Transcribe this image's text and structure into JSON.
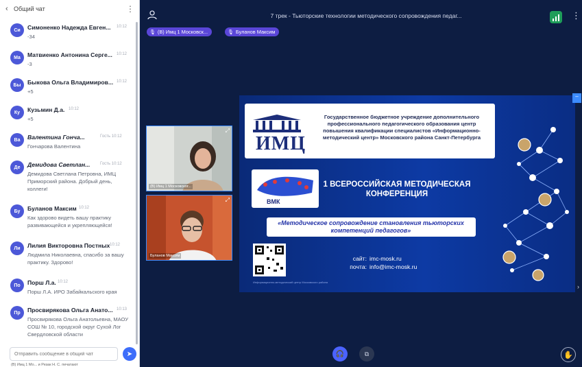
{
  "chat": {
    "header_title": "Общий чат",
    "back_glyph": "‹",
    "menu_glyph": "⋮",
    "messages": [
      {
        "initials": "Си",
        "name": "Симоненко Надежда Евген...",
        "time": "10:12",
        "body": "-34",
        "italic": false
      },
      {
        "initials": "Ма",
        "name": "Матвиенко Антонина Серге...",
        "time": "10:12",
        "body": "-3",
        "italic": false
      },
      {
        "initials": "Бы",
        "name": "Быкова Ольга Владимиров...",
        "time": "10:12",
        "body": "+5",
        "italic": false
      },
      {
        "initials": "Ку",
        "name": "Кузьмин Д.а.",
        "time": "10:12",
        "body": "+5",
        "italic": false
      },
      {
        "initials": "Ва",
        "name": "Валентина Гонча...",
        "time": "Гость 10:12",
        "body": "Гончарова Валентина",
        "italic": true
      },
      {
        "initials": "Де",
        "name": "Демидова Светлан...",
        "time": "Гость 10:12",
        "body": "Демидова Светлана Петровна, ИМЦ Приморский района. Добрый день, коллеги!",
        "italic": true
      },
      {
        "initials": "Бу",
        "name": "Буланов Максим",
        "time": "10:12",
        "body": "Как здорово видеть вашу практику развивающейся и укрепляющейся!",
        "italic": false
      },
      {
        "initials": "Ли",
        "name": "Лилия Викторовна Постных",
        "time": "10:12",
        "body": "Людмила Николаевна, спасибо за вашу практику. Здорово!",
        "italic": false
      },
      {
        "initials": "По",
        "name": "Порш Л.а.",
        "time": "10:12",
        "body": "Порш Л.А. ИРО Забайкальского края",
        "italic": false
      },
      {
        "initials": "Пр",
        "name": "Просвирякова Ольга Анато...",
        "time": "10:13",
        "body": "Просвирякова Ольга Анатольевна, МАОУ СОШ № 10, городской округ Сухой Лог Свердловской области",
        "italic": false
      }
    ],
    "input_placeholder": "Отправить сообщение в общий чат",
    "send_glyph": "➤",
    "status_line": "(В) Имц 1 Мо... и Резак Н. С. печатают"
  },
  "topbar": {
    "conference_title": "7 трек - Тьюторские технологии методического сопровождения педаг...",
    "menu_glyph": "⋮",
    "pinned": [
      {
        "label": "(В) Имц 1 Московск...",
        "mic": "🎙"
      },
      {
        "label": "Буланов Максим",
        "mic": "🎙"
      }
    ]
  },
  "tiles": [
    {
      "label": "(В) Имц 1 Московског...",
      "expand": "⤢"
    },
    {
      "label": "Буланов Максим",
      "expand": "⤢"
    }
  ],
  "slide": {
    "org_text": "Государственное бюджетное учреждение дополнительного профессионального педагогического образования центр повышения квалификации специалистов «Информационно-методический центр» Московского района Санкт-Петербурга",
    "logo_text": "ИМЦ",
    "vmk_text": "ВМК",
    "conference_name": "1 ВСЕРОССИЙСКАЯ МЕТОДИЧЕСКАЯ КОНФЕРЕНЦИЯ",
    "subtitle": "«Методическое сопровождение становления тьюторских компетенций педагогов»",
    "site_key": "сайт:",
    "site_value": "imc-mosk.ru",
    "mail_key": "почта:",
    "mail_value": "info@imc-mosk.ru",
    "footnote": "Информационно-методический центр Московского района"
  },
  "controls": {
    "mic_glyph": "🎧",
    "cam_glyph": "⧉",
    "hand_glyph": "✋",
    "side_btn_glyph": "–",
    "side_arrow_glyph": "›"
  },
  "colors": {
    "avatar": "#4c58d8",
    "pin": "#5a46d8",
    "accent": "#3d6dfa",
    "tile_border": "#3d8cff",
    "network_good": "#1f9d5a"
  }
}
